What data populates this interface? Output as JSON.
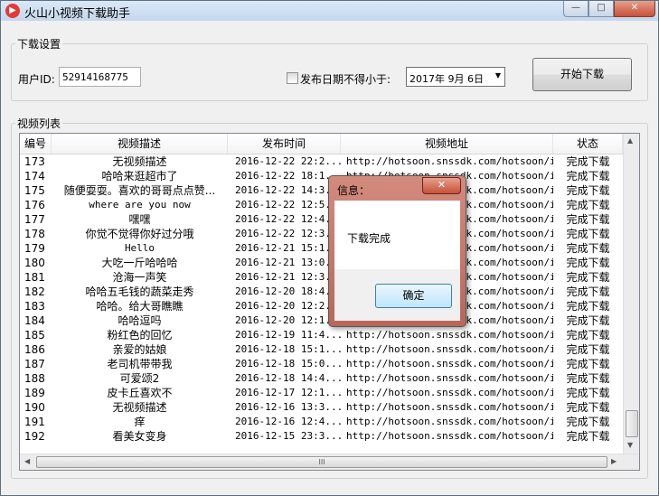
{
  "window": {
    "title": "火山小视频下载助手",
    "min_symbol": "—",
    "max_symbol": "□",
    "close_symbol": "✕"
  },
  "settings": {
    "legend": "下载设置",
    "user_id_label": "用户ID:",
    "user_id_value": "52914168775",
    "date_filter_label": "发布日期不得小于:",
    "date_filter_checked": false,
    "date_value": "2017年 9月 6日",
    "start_button": "开始下载"
  },
  "video_list": {
    "legend": "视频列表",
    "columns": [
      "编号",
      "视频描述",
      "发布时间",
      "视频地址",
      "状态"
    ],
    "rows": [
      [
        "173",
        "无视频描述",
        "2016-12-22 22:2...",
        "http://hotsoon.snssdk.com/hotsoon/i...",
        "完成下载"
      ],
      [
        "174",
        "哈哈来逛超市了",
        "2016-12-22 18:1...",
        "http://hotsoon.snssdk.com/hotsoon/i...",
        "完成下载"
      ],
      [
        "175",
        "随便耍耍。喜欢的哥哥点点赞...",
        "2016-12-22 14:3...",
        "http://hotsoon.snssdk.com/hotsoon/i...",
        "完成下载"
      ],
      [
        "176",
        "where are you now",
        "2016-12-22 12:5...",
        "http://hotsoon.snssdk.com/hotsoon/i...",
        "完成下载"
      ],
      [
        "177",
        "嘿嘿",
        "2016-12-22 12:4...",
        "http://hotsoon.snssdk.com/hotsoon/i...",
        "完成下载"
      ],
      [
        "178",
        "你觉不觉得你好过分哦",
        "2016-12-22 12:3...",
        "http://hotsoon.snssdk.com/hotsoon/i...",
        "完成下载"
      ],
      [
        "179",
        "Hello",
        "2016-12-21 15:1...",
        "http://hotsoon.snssdk.com/hotsoon/i...",
        "完成下载"
      ],
      [
        "180",
        "大吃一斤哈哈哈",
        "2016-12-21 13:0...",
        "http://hotsoon.snssdk.com/hotsoon/i...",
        "完成下载"
      ],
      [
        "181",
        "沧海一声笑",
        "2016-12-21 12:3...",
        "http://hotsoon.snssdk.com/hotsoon/i...",
        "完成下载"
      ],
      [
        "182",
        "哈哈五毛钱的蔬菜走秀",
        "2016-12-20 18:4...",
        "http://hotsoon.snssdk.com/hotsoon/i...",
        "完成下载"
      ],
      [
        "183",
        "哈哈。给大哥瞧瞧",
        "2016-12-20 12:2...",
        "http://hotsoon.snssdk.com/hotsoon/i...",
        "完成下载"
      ],
      [
        "184",
        "哈哈逗吗",
        "2016-12-20 12:1...",
        "http://hotsoon.snssdk.com/hotsoon/i...",
        "完成下载"
      ],
      [
        "185",
        "粉红色的回忆",
        "2016-12-19 11:4...",
        "http://hotsoon.snssdk.com/hotsoon/i...",
        "完成下载"
      ],
      [
        "186",
        "亲爱的姑娘",
        "2016-12-18 15:1...",
        "http://hotsoon.snssdk.com/hotsoon/i...",
        "完成下载"
      ],
      [
        "187",
        "老司机带带我",
        "2016-12-18 15:0...",
        "http://hotsoon.snssdk.com/hotsoon/i...",
        "完成下载"
      ],
      [
        "188",
        "可爱颂2",
        "2016-12-18 14:4...",
        "http://hotsoon.snssdk.com/hotsoon/i...",
        "完成下载"
      ],
      [
        "189",
        "皮卡丘喜欢不",
        "2016-12-17 12:1...",
        "http://hotsoon.snssdk.com/hotsoon/i...",
        "完成下载"
      ],
      [
        "190",
        "无视频描述",
        "2016-12-16 13:3...",
        "http://hotsoon.snssdk.com/hotsoon/i...",
        "完成下载"
      ],
      [
        "191",
        "痒",
        "2016-12-16 12:4...",
        "http://hotsoon.snssdk.com/hotsoon/i...",
        "完成下载"
      ],
      [
        "192",
        "看美女变身",
        "2016-12-15 23:3...",
        "http://hotsoon.snssdk.com/hotsoon/i...",
        "完成下载"
      ]
    ],
    "hscroll_grip": "III"
  },
  "dialog": {
    "title": "信息：",
    "close_symbol": "✕",
    "message": "下载完成",
    "ok_button": "确定"
  },
  "colors": {
    "accent": "#3c7fb1",
    "close_red": "#c6513a"
  }
}
